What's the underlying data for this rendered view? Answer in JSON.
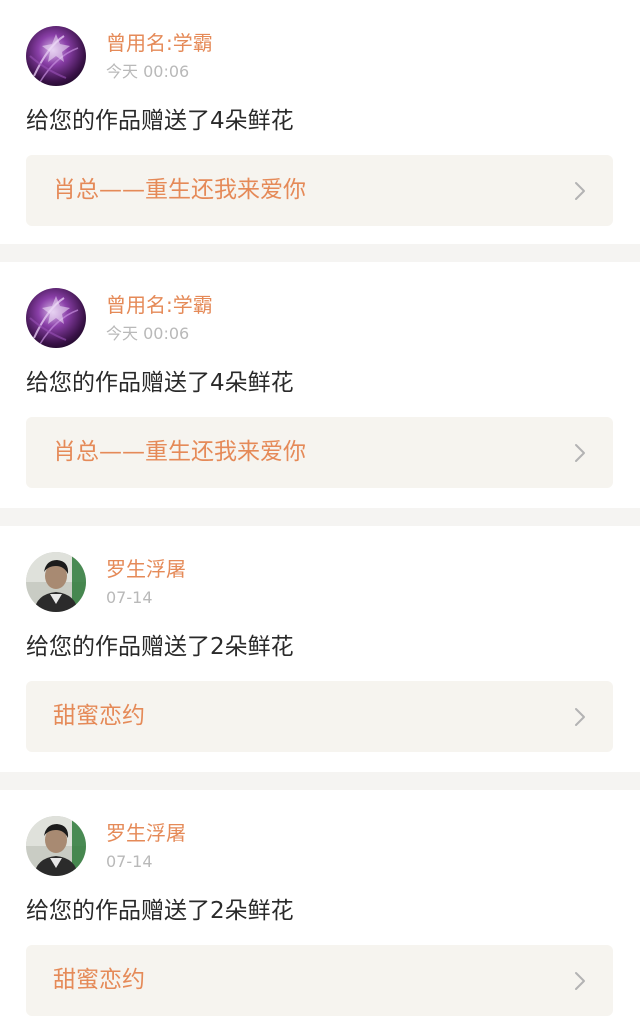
{
  "colors": {
    "accent": "#e58a58",
    "muted": "#b9b9b9",
    "body_text": "#2a2a2a",
    "card_bg": "#ffffff",
    "link_bg": "#f6f4ef",
    "page_bg": "#f5f4f2"
  },
  "notifications": [
    {
      "user_name": "曾用名:学霸",
      "time": "今天 00:06",
      "message": "给您的作品赠送了4朵鲜花",
      "work_title": "肖总——重生还我来爱你",
      "chevron_icon": "chevron-right-icon"
    },
    {
      "user_name": "曾用名:学霸",
      "time": "今天 00:06",
      "message": "给您的作品赠送了4朵鲜花",
      "work_title": "肖总——重生还我来爱你",
      "chevron_icon": "chevron-right-icon"
    },
    {
      "user_name": "罗生浮屠",
      "time": "07-14",
      "message": "给您的作品赠送了2朵鲜花",
      "work_title": "甜蜜恋约",
      "chevron_icon": "chevron-right-icon"
    },
    {
      "user_name": "罗生浮屠",
      "time": "07-14",
      "message": "给您的作品赠送了2朵鲜花",
      "work_title": "甜蜜恋约",
      "chevron_icon": "chevron-right-icon"
    }
  ]
}
